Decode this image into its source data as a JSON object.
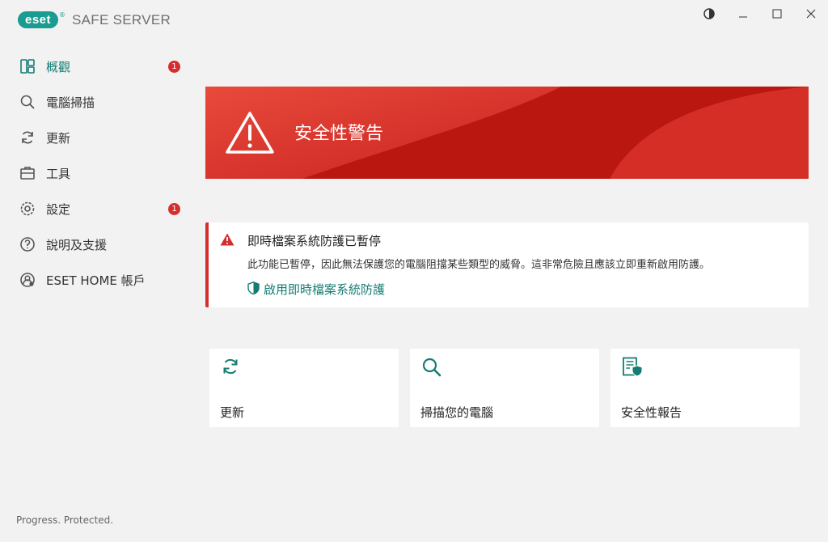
{
  "app": {
    "logo_text": "eset",
    "logo_sup": "®",
    "product_name": "SAFE SERVER"
  },
  "window_controls": [
    "contrast-icon",
    "minimize-icon",
    "maximize-icon",
    "close-icon"
  ],
  "sidebar": {
    "items": [
      {
        "label": "概觀",
        "icon": "overview-icon",
        "badge": "1",
        "active": true
      },
      {
        "label": "電腦掃描",
        "icon": "search-icon"
      },
      {
        "label": "更新",
        "icon": "refresh-icon"
      },
      {
        "label": "工具",
        "icon": "toolbox-icon"
      },
      {
        "label": "設定",
        "icon": "gear-icon",
        "badge": "1"
      },
      {
        "label": "說明及支援",
        "icon": "help-icon"
      },
      {
        "label": "ESET HOME 帳戶",
        "icon": "account-icon"
      }
    ],
    "footer": "Progress. Protected."
  },
  "banner": {
    "title": "安全性警告",
    "icon": "warning-triangle-icon",
    "color": "#c8211f"
  },
  "alert": {
    "title": "即時檔案系統防護已暫停",
    "description": "此功能已暫停，因此無法保護您的電腦阻擋某些類型的威脅。這非常危險且應該立即重新啟用防護。",
    "link_label": "啟用即時檔案系統防護",
    "icon": "warning-icon",
    "link_icon": "shield-icon"
  },
  "tiles": [
    {
      "label": "更新",
      "icon": "refresh-icon"
    },
    {
      "label": "掃描您的電腦",
      "icon": "search-icon"
    },
    {
      "label": "安全性報告",
      "icon": "report-icon"
    }
  ],
  "colors": {
    "accent": "#137d74",
    "brand": "#1a9c91",
    "alert_red": "#d32f2f"
  }
}
